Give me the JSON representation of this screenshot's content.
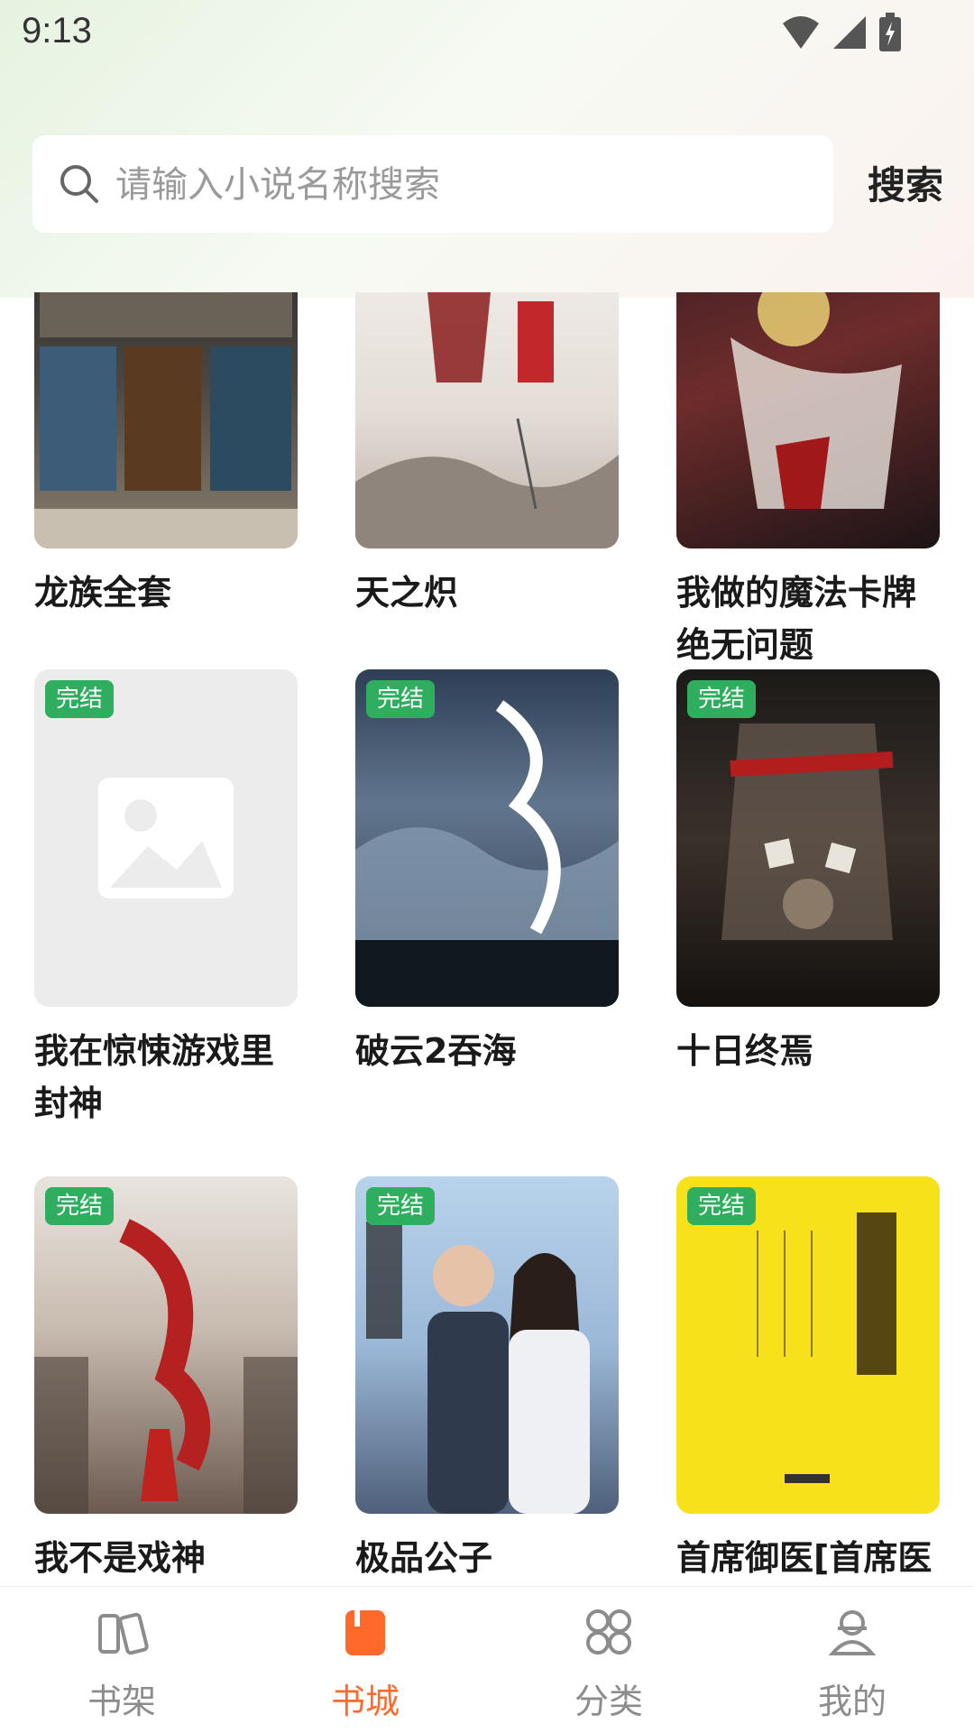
{
  "status_bar": {
    "time": "9:13"
  },
  "search": {
    "placeholder": "请输入小说名称搜索",
    "button_label": "搜索"
  },
  "books": [
    {
      "title": "龙族全套",
      "badge": ""
    },
    {
      "title": "天之炽",
      "badge": ""
    },
    {
      "title": "我做的魔法卡牌绝无问题",
      "badge": ""
    },
    {
      "title": "我在惊悚游戏里封神",
      "badge": "完结"
    },
    {
      "title": "破云2吞海",
      "badge": "完结"
    },
    {
      "title": "十日终焉",
      "badge": "完结"
    },
    {
      "title": "我不是戏神",
      "badge": "完结"
    },
    {
      "title": "极品公子",
      "badge": "完结"
    },
    {
      "title": "首席御医[首席医",
      "badge": "完结"
    }
  ],
  "nav": {
    "items": [
      {
        "label": "书架",
        "icon": "bookshelf-icon"
      },
      {
        "label": "书城",
        "icon": "bookstore-icon"
      },
      {
        "label": "分类",
        "icon": "category-icon"
      },
      {
        "label": "我的",
        "icon": "profile-icon"
      }
    ],
    "active_color": "#ff6a2b",
    "inactive_color": "#8c8c8c"
  },
  "colors": {
    "badge": "#2fae5f"
  }
}
